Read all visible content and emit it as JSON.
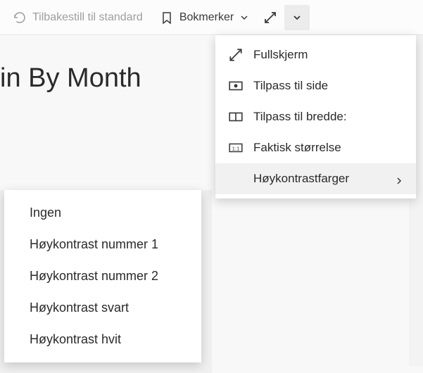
{
  "toolbar": {
    "reset_label": "Tilbakestill til standard",
    "bookmarks_label": "Bokmerker"
  },
  "heading": "in By Month",
  "menu": {
    "fullscreen": "Fullskjerm",
    "fit_page": "Tilpass til side",
    "fit_width": "Tilpass til bredde:",
    "actual_size": "Faktisk størrelse",
    "high_contrast": "Høykontrastfarger"
  },
  "submenu": {
    "none": "Ingen",
    "hc1": "Høykontrast nummer 1",
    "hc2": "Høykontrast nummer 2",
    "hc_black": "Høykontrast svart",
    "hc_white": "Høykontrast hvit"
  }
}
